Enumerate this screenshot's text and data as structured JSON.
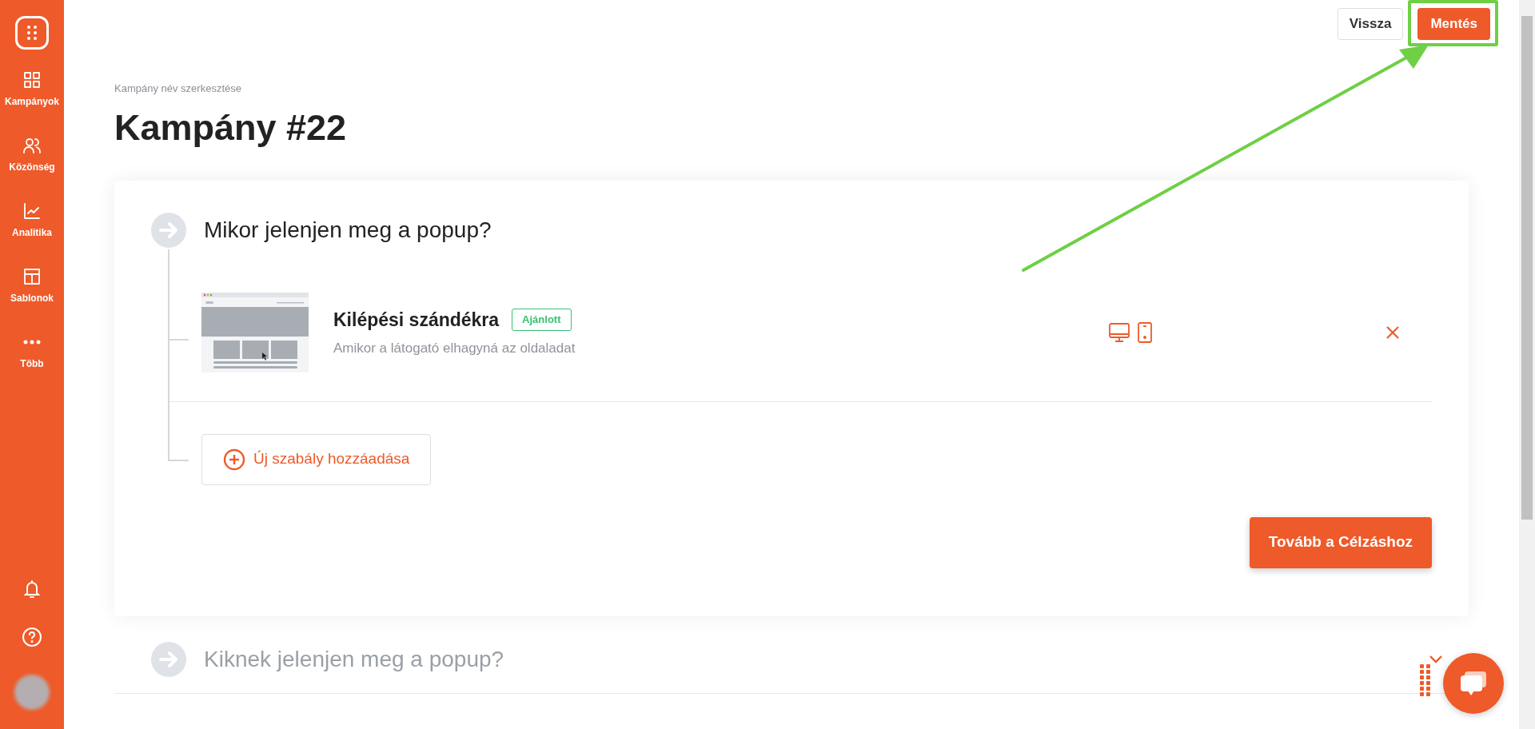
{
  "sidebar": {
    "items": [
      {
        "label": "Kampányok",
        "kind": "grid",
        "selected": false
      },
      {
        "label": "Közönség",
        "kind": "users",
        "selected": false
      },
      {
        "label": "Analitika",
        "kind": "chart",
        "selected": false
      },
      {
        "label": "Sablonok",
        "kind": "layout",
        "selected": false
      },
      {
        "label": "Több",
        "kind": "dots",
        "selected": false
      }
    ]
  },
  "header": {
    "buttons": [
      {
        "label": "Vissza",
        "kind": "secondary",
        "highlighted": false
      },
      {
        "label": "Mentés",
        "kind": "primary",
        "highlighted": true
      }
    ]
  },
  "breadcrumb": "Kampány név szerkesztése",
  "title": "Kampány #22",
  "steps": [
    {
      "title": "Mikor jelenjen meg a popup?",
      "expanded": true,
      "rules": [
        {
          "name": "Kilépési szándékra",
          "badge": "Ajánlott",
          "description": "Amikor a látogató elhagyná az oldaladat",
          "desktop": true,
          "mobile": true
        }
      ],
      "add_button": "Új szabály hozzáadása",
      "next_button": "Tovább a Célzáshoz"
    },
    {
      "title": "Kiknek jelenjen meg a popup?",
      "expanded": false
    }
  ]
}
